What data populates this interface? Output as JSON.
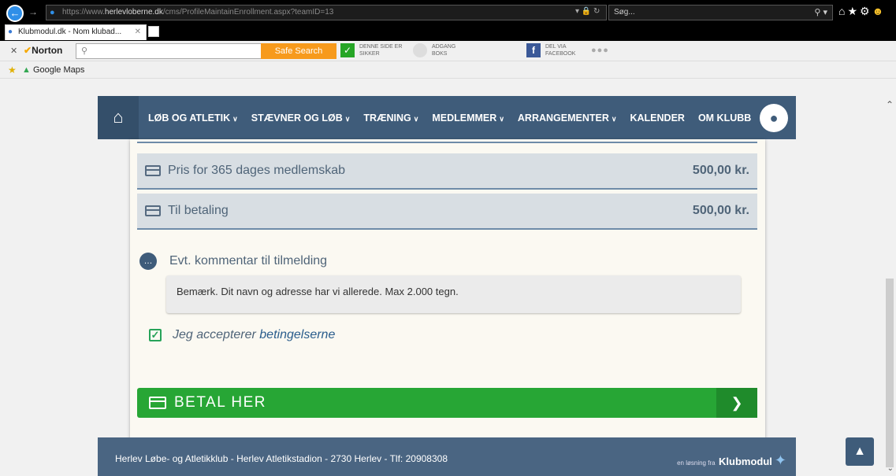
{
  "browser": {
    "url_prefix": "https://www.",
    "url_domain": "herlevloberne.dk",
    "url_path": "/cms/ProfileMaintainEnrollment.aspx?teamID=13",
    "search_placeholder": "Søg...",
    "tab_title": "Klubmodul.dk - Nom klubad...",
    "norton_label": "Norton",
    "safe_search_label": "Safe Search",
    "toolbar_items": [
      {
        "line1": "DENNE SIDE ER",
        "line2": "SIKKER"
      },
      {
        "line1": "ADGANG",
        "line2": "BOKS"
      },
      {
        "line1": "DEL VIA",
        "line2": "FACEBOOK"
      }
    ],
    "favorite": "Google Maps"
  },
  "nav": {
    "items": [
      {
        "label": "LØB OG ATLETIK",
        "has_dropdown": true
      },
      {
        "label": "STÆVNER OG LØB",
        "has_dropdown": true
      },
      {
        "label": "TRÆNING",
        "has_dropdown": true
      },
      {
        "label": "MEDLEMMER",
        "has_dropdown": true
      },
      {
        "label": "ARRANGEMENTER",
        "has_dropdown": true
      },
      {
        "label": "KALENDER",
        "has_dropdown": false
      },
      {
        "label": "OM KLUBB",
        "has_dropdown": false
      }
    ]
  },
  "enrollment": {
    "price_row": {
      "label": "Pris for 365  dages medlemskab",
      "amount": "500,00 kr."
    },
    "total_row": {
      "label": "Til betaling",
      "amount": "500,00 kr."
    },
    "comment_label": "Evt. kommentar til tilmelding",
    "comment_placeholder": "Bemærk. Dit navn og adresse har vi allerede. Max 2.000 tegn.",
    "accept_text": "Jeg accepterer ",
    "accept_link": "betingelserne",
    "accept_checked": true,
    "pay_button": "BETAL HER"
  },
  "footer": {
    "text": "Herlev Løbe- og Atletikklub - Herlev Atletikstadion - 2730 Herlev - Tlf: 20908308",
    "brand_small": "en løsning fra",
    "brand_name": "Klubmodul"
  },
  "colors": {
    "nav_bg": "#3f5c7a",
    "pay_green": "#27a635",
    "row_bg": "#d8dee3",
    "card_bg": "#fbf9f2"
  }
}
